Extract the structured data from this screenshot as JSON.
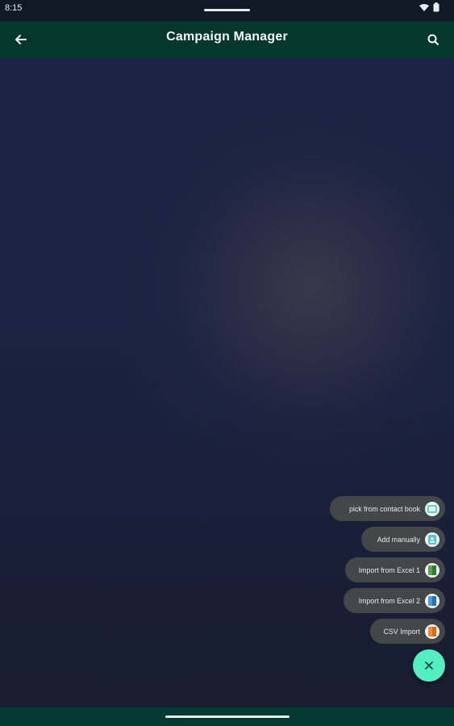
{
  "status_bar": {
    "time": "8:15"
  },
  "app_bar": {
    "title": "Campaign Manager"
  },
  "fab_menu": {
    "items": [
      {
        "label": "pick from contact book",
        "icon": "contacts-icon",
        "icon_color": "#57d7b9"
      },
      {
        "label": "Add manually",
        "icon": "add-contact-icon",
        "icon_color": "#4fc7d2"
      },
      {
        "label": "Import from Excel 1",
        "icon": "excel-file-icon",
        "icon_color": "#58a64d"
      },
      {
        "label": "Import from Excel 2",
        "icon": "excel-file-2-icon",
        "icon_color": "#4b97e0"
      },
      {
        "label": "CSV Import",
        "icon": "csv-file-icon",
        "icon_color": "#f08c2a"
      }
    ],
    "close_icon": "close-icon",
    "close_color": "#53efc0"
  },
  "colors": {
    "app_bar": "#05372f",
    "background": "#1b2243",
    "chip": "#444748"
  }
}
